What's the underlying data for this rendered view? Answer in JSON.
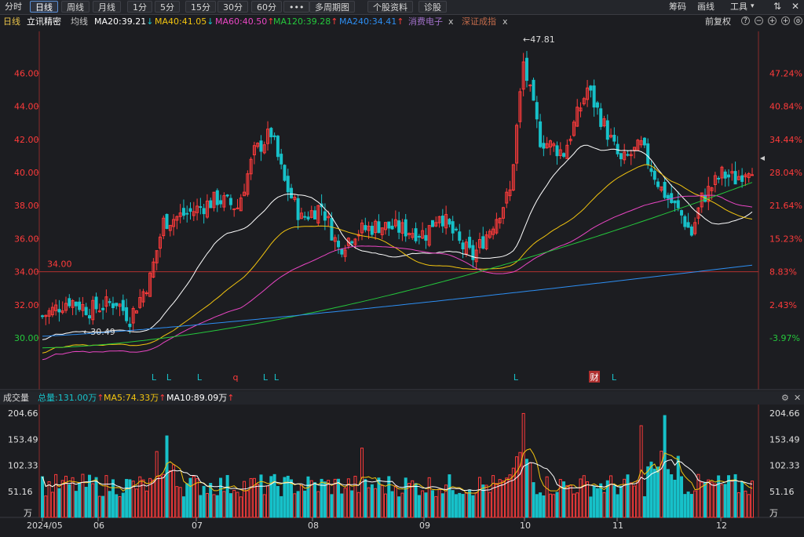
{
  "toolbar": {
    "left": [
      "分时",
      "日线",
      "周线",
      "月线",
      "1分",
      "5分",
      "15分",
      "30分",
      "60分",
      "•••",
      "多周期图",
      "个股资料",
      "诊股"
    ],
    "active": "日线",
    "right": [
      "筹码",
      "画线",
      "工具"
    ],
    "window_icons": [
      "sync-icon",
      "close-icon"
    ]
  },
  "ma_line": {
    "period": "日线",
    "stock": "立讯精密",
    "avg_label": "均线",
    "ma20": "MA20:39.21",
    "ma20_arrow": "↓",
    "ma40": "MA40:41.05",
    "ma40_arrow": "↓",
    "ma60": "MA60:40.50",
    "ma60_arrow": "↑",
    "ma120": "MA120:39.28",
    "ma120_arrow": "↑",
    "ma240": "MA240:34.41",
    "ma240_arrow": "↑",
    "overlay1": "消费电子",
    "overlay2": "深证成指",
    "remove": "x",
    "adjust": "前复权",
    "controls": [
      "?",
      "−",
      "+",
      "+"
    ]
  },
  "price_chart": {
    "left_ticks": [
      "46.00",
      "44.00",
      "42.00",
      "40.00",
      "38.00",
      "36.00",
      "34.00",
      "32.00",
      "30.00"
    ],
    "right_ticks": [
      "47.24%",
      "40.84%",
      "34.44%",
      "28.04%",
      "21.64%",
      "15.23%",
      "8.83%",
      "2.43%",
      "-3.97%"
    ],
    "hline_label": "34.00",
    "high_label": "←47.81",
    "low_label": "←30.49",
    "markers": [
      "L",
      "L",
      "L",
      "q",
      "L",
      "L",
      "L",
      "财",
      "L"
    ],
    "colors": {
      "up": "#ff3b3b",
      "down": "#17c1c9",
      "ma20": "#ffffff",
      "ma40": "#f2c40f",
      "ma60": "#ea46c4",
      "ma120": "#25c83c",
      "ma240": "#2d8ef2"
    }
  },
  "volume_header": {
    "title": "成交量",
    "total": "总量:131.00万",
    "total_arrow": "↑",
    "ma5": "MA5:74.33万",
    "ma5_arrow": "↑",
    "ma10": "MA10:89.09万",
    "ma10_arrow": "↑"
  },
  "volume_chart": {
    "ticks": [
      "204.66",
      "153.49",
      "102.33",
      "51.16"
    ],
    "unit": "万"
  },
  "x_axis": [
    "2024/05",
    "06",
    "07",
    "08",
    "09",
    "10",
    "11",
    "12"
  ]
}
